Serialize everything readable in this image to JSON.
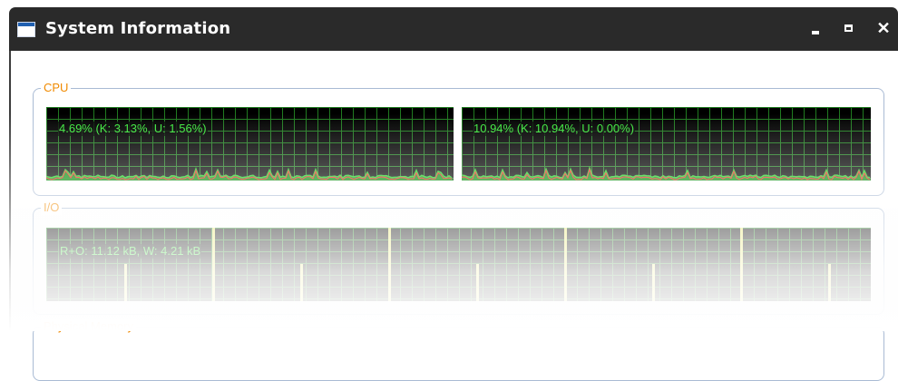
{
  "window": {
    "title": "System Information",
    "buttons": {
      "minimize": "minimize",
      "maximize": "maximize",
      "close": "✕"
    }
  },
  "groups": {
    "cpu": {
      "label": "CPU",
      "graphs": [
        {
          "text": "4.69% (K: 3.13%, U: 1.56%)"
        },
        {
          "text": "10.94% (K: 10.94%, U: 0.00%)"
        }
      ]
    },
    "io": {
      "label": "I/O",
      "text": "R+O: 11.12 kB, W: 4.21 kB"
    },
    "memory": {
      "label": "Physical Memory"
    }
  },
  "colors": {
    "title_bar": "#2a2a2a",
    "group_label": "#f08a00",
    "graph_text": "#39e639",
    "grid": "#1f7a1f",
    "io_spike": "#e8e870",
    "cpu_kernel": "#ff2020"
  }
}
